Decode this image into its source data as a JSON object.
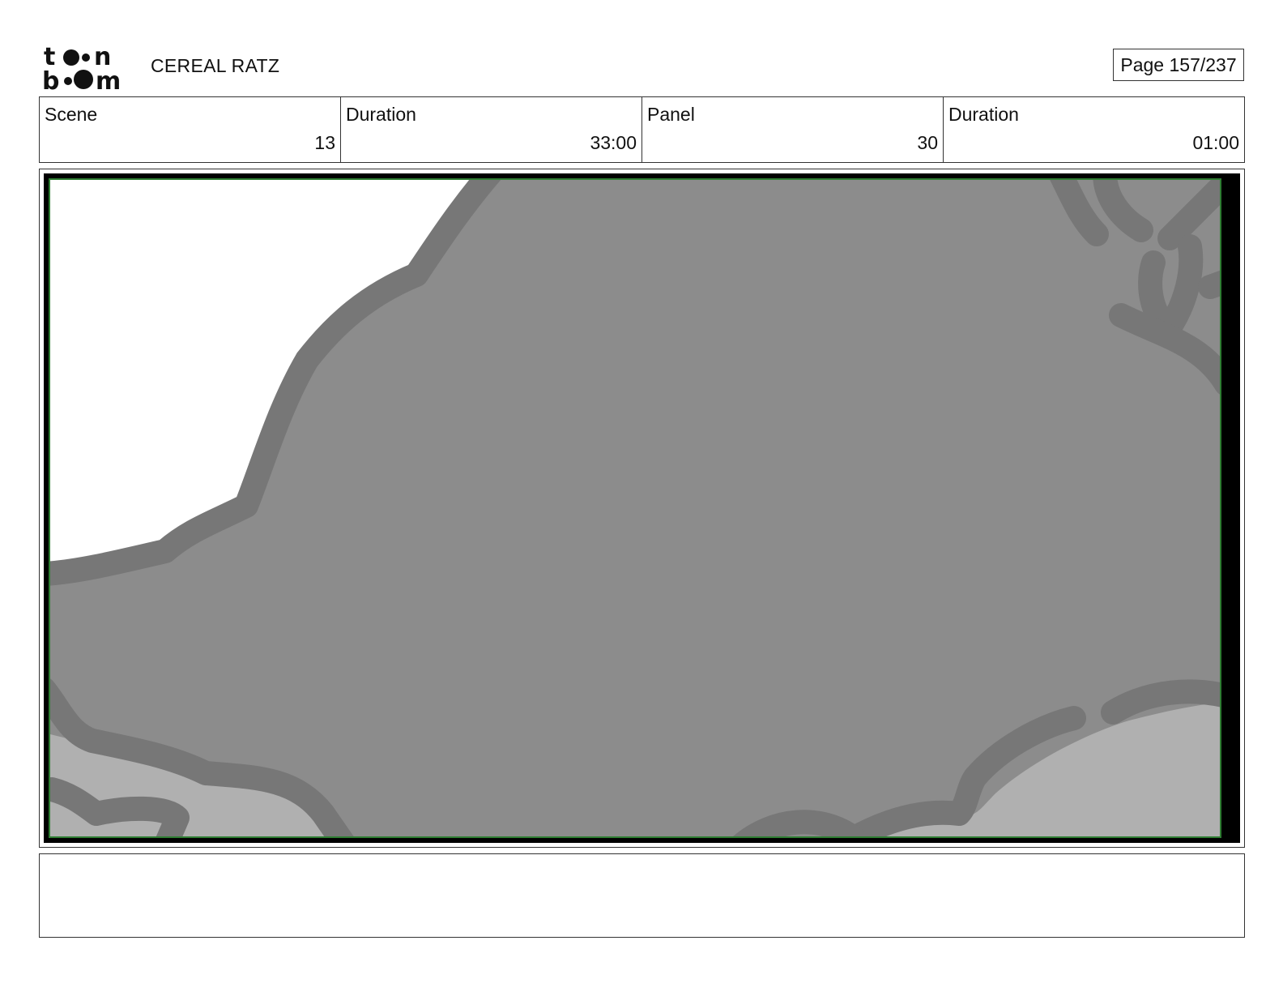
{
  "header": {
    "logo_text": "toon boom",
    "project_title": "CEREAL RATZ",
    "page_label": "Page 157/237"
  },
  "info": {
    "scene_label": "Scene",
    "scene_value": "13",
    "scene_duration_label": "Duration",
    "scene_duration_value": "33:00",
    "panel_label": "Panel",
    "panel_value": "30",
    "panel_duration_label": "Duration",
    "panel_duration_value": "01:00"
  },
  "panel": {
    "frame_color": "#000000",
    "safe_area_color": "#2e7d32",
    "fill_dark": "#8c8c8c",
    "fill_light": "#b0b0b0",
    "stroke": "#777777"
  },
  "notes": {
    "text": ""
  }
}
